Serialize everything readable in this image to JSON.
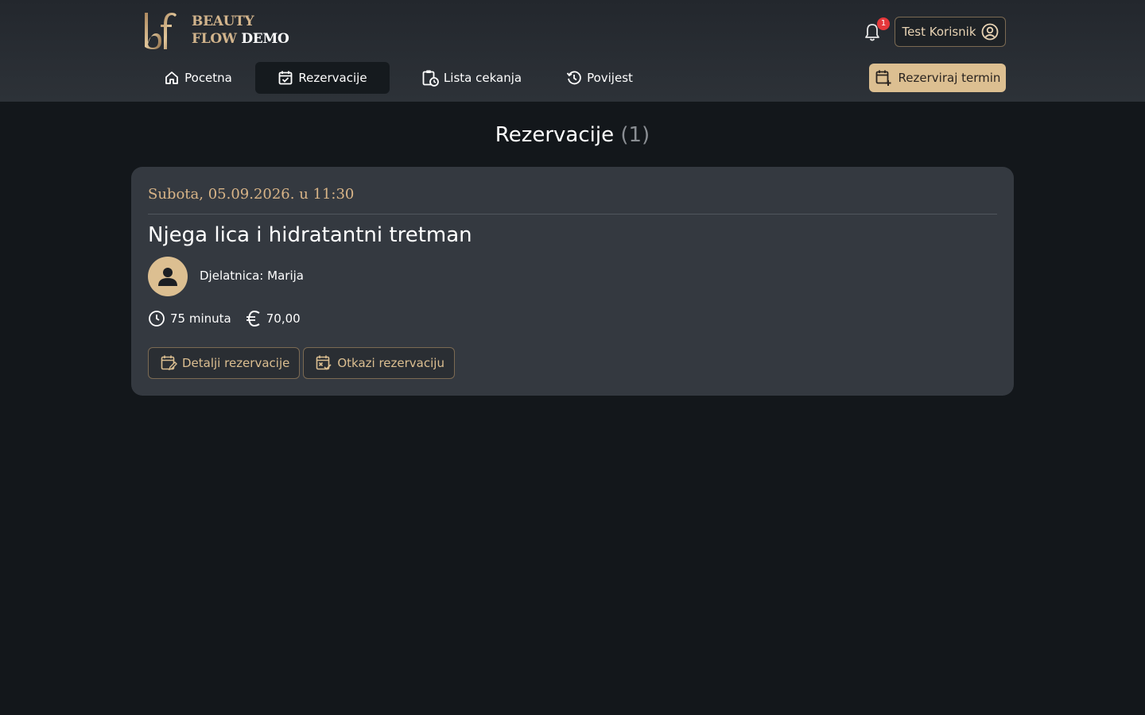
{
  "brand": {
    "line1": "BEAUTY",
    "line2_gold": "FLOW",
    "line2_white": "DEMO"
  },
  "header": {
    "notifications_count": "1",
    "user_name": "Test Korisnik",
    "book_button": "Rezerviraj termin"
  },
  "nav": {
    "items": [
      {
        "label": "Pocetna",
        "icon": "home-icon"
      },
      {
        "label": "Rezervacije",
        "icon": "calendar-check-icon",
        "active": true
      },
      {
        "label": "Lista cekanja",
        "icon": "clipboard-clock-icon"
      },
      {
        "label": "Povijest",
        "icon": "history-icon"
      }
    ]
  },
  "main": {
    "title": "Rezervacije",
    "count": "(1)"
  },
  "reservation": {
    "date": "Subota, 05.09.2026. u 11:30",
    "service": "Njega lica i hidratantni tretman",
    "employee_label": "Djelatnica:",
    "employee_name": "Marija",
    "duration": "75 minuta",
    "price": "70,00",
    "details_button": "Detalji rezervacije",
    "cancel_button": "Otkazi rezervaciju"
  },
  "colors": {
    "accent_gold": "#dcbf91",
    "header_bg": "#2a2e34",
    "page_bg": "#13171b",
    "card_bg": "#343940",
    "badge_red": "#e5383b"
  }
}
